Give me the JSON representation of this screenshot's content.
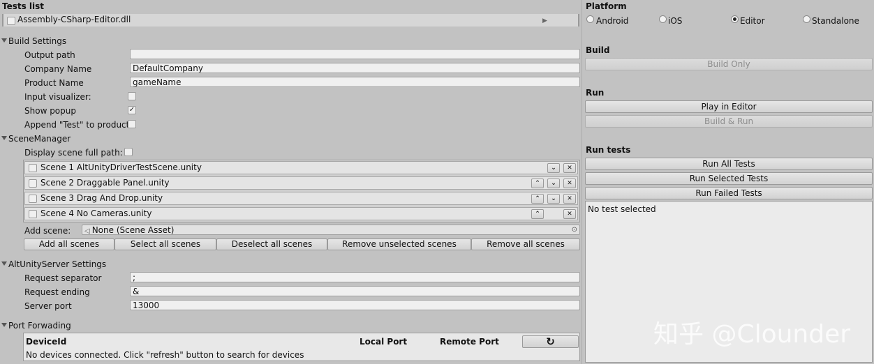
{
  "tests_list": {
    "title": "Tests list",
    "assembly": "Assembly-CSharp-Editor.dll",
    "expand_glyph": "▶"
  },
  "build_settings": {
    "title": "Build Settings",
    "output_path_label": "Output path",
    "output_path_value": "",
    "company_label": "Company Name",
    "company_value": "DefaultCompany",
    "product_label": "Product Name",
    "product_value": "gameName",
    "input_visualizer_label": "Input visualizer:",
    "input_visualizer_checked": false,
    "show_popup_label": "Show popup",
    "show_popup_checked": true,
    "append_test_label": "Append \"Test\" to product",
    "append_test_checked": false,
    "check_glyph": "✓"
  },
  "scene_manager": {
    "title": "SceneManager",
    "display_full_path_label": "Display scene full path:",
    "scenes": [
      {
        "label": "Scene 1 AltUnityDriverTestScene.unity"
      },
      {
        "label": "Scene 2 Draggable Panel.unity"
      },
      {
        "label": "Scene 3 Drag And Drop.unity"
      },
      {
        "label": "Scene 4 No Cameras.unity"
      }
    ],
    "add_scene_label": "Add scene:",
    "add_scene_value": "None (Scene Asset)",
    "buttons": {
      "add_all": "Add all scenes",
      "select_all": "Select all scenes",
      "deselect_all": "Deselect all scenes",
      "remove_unselected": "Remove unselected scenes",
      "remove_all": "Remove all scenes"
    },
    "up_glyph": "⌃",
    "down_glyph": "⌄",
    "remove_glyph": "✕"
  },
  "server_settings": {
    "title": "AltUnityServer Settings",
    "separator_label": "Request separator",
    "separator_value": ";",
    "ending_label": "Request ending",
    "ending_value": "&",
    "port_label": "Server port",
    "port_value": "13000"
  },
  "port_forwarding": {
    "title": "Port Forwading",
    "col_device": "DeviceId",
    "col_local": "Local Port",
    "col_remote": "Remote Port",
    "message": "No devices connected. Click \"refresh\" button to search for devices"
  },
  "platform": {
    "title": "Platform",
    "options": [
      "Android",
      "iOS",
      "Editor",
      "Standalone"
    ],
    "selected": "Editor"
  },
  "build": {
    "title": "Build",
    "build_only": "Build Only"
  },
  "run": {
    "title": "Run",
    "play_in_editor": "Play in Editor",
    "build_and_run": "Build & Run"
  },
  "run_tests": {
    "title": "Run tests",
    "run_all": "Run All Tests",
    "run_selected": "Run Selected Tests",
    "run_failed": "Run Failed Tests",
    "status": "No test selected"
  },
  "watermark": "知乎 @Clounder"
}
